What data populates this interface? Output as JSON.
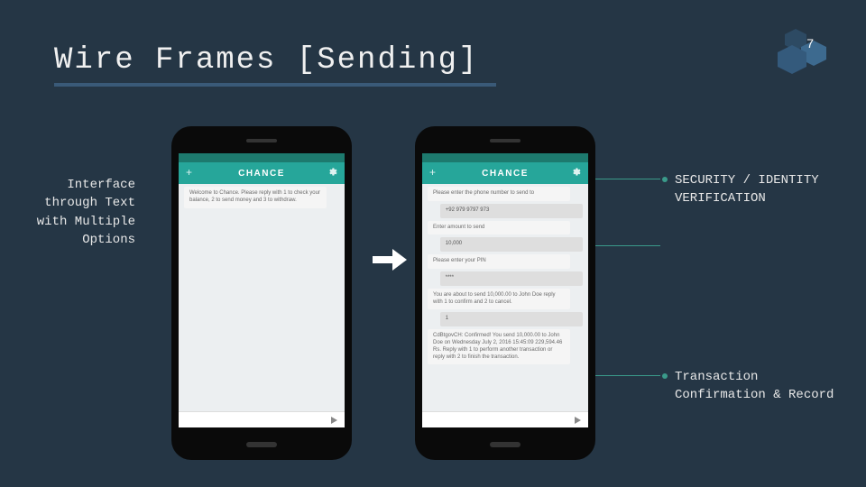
{
  "page_number": "7",
  "title": "Wire Frames [Sending]",
  "left_note": "Interface through Text with Multiple Options",
  "callouts": {
    "security": "SECURITY / IDENTITY VERIFICATION",
    "confirmation": "Transaction Confirmation & Record"
  },
  "phone1": {
    "app_title": "CHANCE",
    "messages": [
      {
        "dir": "in",
        "text": "Welcome to Chance. Please reply with 1 to check your balance, 2 to send money and 3 to withdraw."
      }
    ]
  },
  "phone2": {
    "app_title": "CHANCE",
    "messages": [
      {
        "dir": "in",
        "text": "Please enter the phone number to send to"
      },
      {
        "dir": "out",
        "text": "+92 979 9797 973"
      },
      {
        "dir": "in",
        "text": "Enter amount to send"
      },
      {
        "dir": "out",
        "text": "10,000"
      },
      {
        "dir": "in",
        "text": "Please enter your PIN"
      },
      {
        "dir": "out",
        "text": "****"
      },
      {
        "dir": "in",
        "text": "You are about to send 10,000.00 to John Doe reply with 1 to confirm and 2 to cancel."
      },
      {
        "dir": "out",
        "text": "1"
      },
      {
        "dir": "in",
        "text": "CdBtgovCH: Confirmed! You send 10,000.00 to John Doe on Wednesday July 2, 2016 15:45:09 229,594.46 Rs. Reply with 1 to perform another transaction or reply with 2 to finish the transaction."
      }
    ]
  }
}
